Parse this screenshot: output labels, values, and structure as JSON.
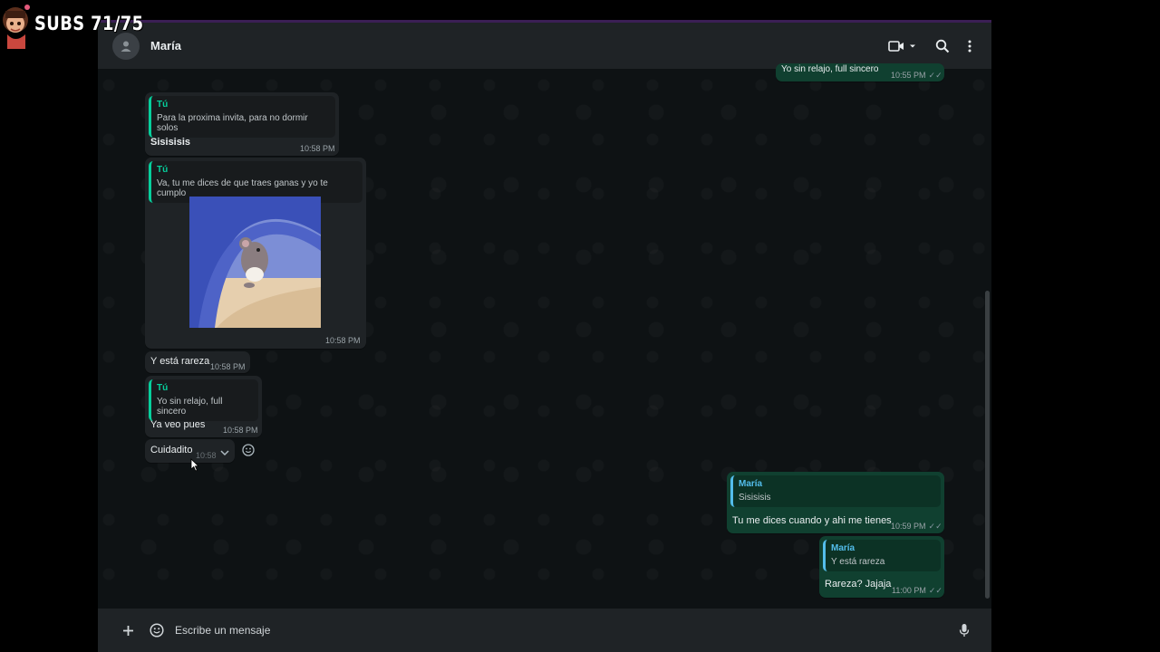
{
  "overlay": {
    "subs_text": "SUBS 71/75"
  },
  "header": {
    "contact_name": "María",
    "icons": [
      "avatar-placeholder-icon",
      "video-call-icon",
      "chevron-down-icon",
      "search-icon",
      "more-options-icon"
    ]
  },
  "messages": [
    {
      "dir": "out",
      "text": "Yo sin relajo, full sincero",
      "time": "10:55 PM"
    },
    {
      "dir": "in",
      "quote_author": "Tú",
      "quote_text": "Para la proxima invita, para no dormir solos",
      "text": "Sisisisis",
      "time": "10:58 PM"
    },
    {
      "dir": "in",
      "quote_author": "Tú",
      "quote_text": "Va, tu me dices de que traes ganas y yo te cumplo",
      "image": "cartoon-mouse-under-blanket",
      "time": "10:58 PM"
    },
    {
      "dir": "in",
      "text": "Y está rareza",
      "time": "10:58 PM"
    },
    {
      "dir": "in",
      "quote_author": "Tú",
      "quote_text": "Yo sin relajo, full sincero",
      "text": "Ya veo pues",
      "time": "10:58 PM"
    },
    {
      "dir": "in",
      "text": "Cuidadito",
      "time": "10:58"
    },
    {
      "dir": "out",
      "quote_author": "María",
      "quote_text": "Sisisisis",
      "text": "Tu me dices cuando y ahi me tienes",
      "time": "10:59 PM"
    },
    {
      "dir": "out",
      "quote_author": "María",
      "quote_text": "Y está rareza",
      "text": "Rareza? Jajaja",
      "time": "11:00 PM"
    }
  ],
  "input": {
    "placeholder": "Escribe un mensaje"
  },
  "colors": {
    "incoming_bubble": "#1f2326",
    "outgoing_bubble": "#104030",
    "quote_accent_green": "#06cf9c",
    "quote_accent_blue": "#53bdeb"
  }
}
